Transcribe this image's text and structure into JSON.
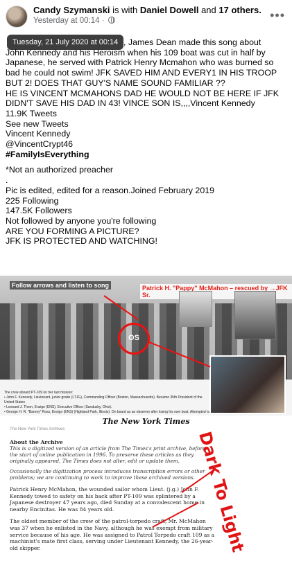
{
  "post": {
    "author": "Candy Szymanski",
    "with_word": "is with",
    "tagged": "Daniel Dowell",
    "and_word": "and",
    "others": "17 others.",
    "timestamp": "Yesterday at 00:14",
    "separator": "·",
    "tooltip": "Tuesday, 21 July 2020 at 00:14",
    "more_icon": "more-options-icon"
  },
  "body_lines": [
    ", James Dean made this song about",
    "John Kennedy and his Heroism when his 109 boat was cut in half by",
    "Japanese, he served with Patrick Henry Mcmahon who was burned so",
    "bad he could not swim! JFK SAVED HIM AND EVERY1 IN HIS TROOP",
    "BUT 2! DOES THAT GUY'S NAME SOUND FAMILIAR ??",
    "HE IS VINCENT MCMAHONS DAD HE WOULD NOT BE HERE IF JFK",
    "DIDN'T SAVE HIS DAD IN 43! VINCE SON IS,,,,Vincent Kennedy",
    "11.9K Tweets",
    "See new Tweets",
    "Vincent Kennedy",
    "@VincentCrypt46",
    "#FamilyIsEverything",
    "*Not an authorized preacher",
    ".",
    "Pic is edited, edited for a reason.Joined February 2019",
    "225 Following",
    "147.5K Followers",
    "Not followed by anyone you're following",
    "ARE YOU FORMING A PICTURE?",
    "JFK IS PROTECTED AND WATCHING!"
  ],
  "photo": {
    "caption_left": "Follow arrows and listen to song",
    "caption_right": "Patrick H. \"Pappy\" McMahon – rescued by →JFK Sr.",
    "ring_label": "OS",
    "crew_caption": [
      "The crew aboard PT-109 on her last mission:",
      "• John F. Kennedy, Lieutenant, junior grade (LTJG), Commanding Officer (Boston, Massachusetts). Became 35th President of the United States",
      "• Leonard J. Thom, Ensign (ENS), Executive Officer (Sandusky, Ohio).",
      "• George H. R. \"Barney\" Ross, Ensign (ENS) (Highland Park, Illinois). On board as an observer after losing his own boat. Attempted to ..."
    ]
  },
  "nyt": {
    "logo": "The New York Times",
    "archive_tag": "The New York Times Archives",
    "about_heading": "About the Archive",
    "about_text": "This is a digitized version of an article from The Times's print archive, before the start of online publication in 1996. To preserve these articles as they originally appeared, The Times does not alter, edit or update them.",
    "about_text2": "Occasionally the digitization process introduces transcription errors or other problems; we are continuing to work to improve these archived versions.",
    "article_p1": "Patrick Henry McMahon, the wounded sailor whom Lieut. (j.g.) John F. Kennedy towed to safety on his back after PT-109 was splintered by a Japanese destroyer 47 years ago, died Sunday at a convalescent home in nearby Encinitas. He was 84 years old.",
    "article_p2": "The oldest member of the crew of the patrol-torpedo craft, Mr. McMahon was 37 when he enlisted in the Navy, although he was exempt from military service because of his age. He was assigned to Patrol Torpedo craft 109 as a machinist's mate first class, serving under Lieutenant Kennedy, the 26-year-old skipper."
  },
  "annotation": {
    "overlay_text": "Dark To Light",
    "color": "#e01414"
  }
}
